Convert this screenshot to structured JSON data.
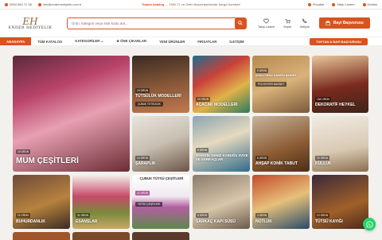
{
  "topbar": {
    "phone": "0554 560 72 38",
    "email": "info@enderhediyelik.com.tr",
    "promo_highlight": "Toptan katalog →",
    "promo_text": "1500 TL ve Üzeri Alışverişlerinizde Kargo Ücretsiz!",
    "links": [
      "Firsatlar",
      "Takip Listem",
      "Destek"
    ]
  },
  "header": {
    "logo_mono": "EH",
    "logo_name": "ENDER HEDIYELIK",
    "search_placeholder": "Ürün, kategori veya stok kodu ara...",
    "icons": [
      "Takip Listem",
      "Sepet",
      "İletişim"
    ],
    "cta": "Bayi Başvurusu"
  },
  "nav": {
    "items": [
      "ANASAYFA",
      "TÜM KATALOG",
      "KATEGORİLER ⌄",
      "★ ÖNE ÇIKANLAR",
      "YENİ ÜRÜNLER",
      "FIRSATLAR",
      "İLETİŞİM"
    ],
    "cta": "TOPTAN & BAYİ BAŞVURUSU"
  },
  "tiles": [
    {
      "id": "mum",
      "badge": "16 ÜRÜN",
      "title": "MUM ÇEŞİTLERİ"
    },
    {
      "id": "tut",
      "badge": "24 ÜRÜN",
      "title": "TÜTSÜLÜK MODELLERİ",
      "btn": "ÇUBUK TÜTSÜLÜK"
    },
    {
      "id": "aca",
      "badge": "20 ÜRÜN",
      "title": "AÇACAK MODELLERİ"
    },
    {
      "id": "ayn",
      "badge": "9 ÜRÜN",
      "title": "AYNALI DENİZ KABUĞU MAGNET",
      "btn": "POLYESTER MAGNET"
    },
    {
      "id": "dek",
      "badge": "154 ÜRÜN",
      "title": "DEKORATİF HEYKEL"
    },
    {
      "id": "sar",
      "badge": "14 ÜRÜN",
      "title": "ŞARAPLIK"
    },
    {
      "id": "sat",
      "badge": "8 ÜRÜN",
      "title": "ATANTİK DENİZ KABUĞU AVİZE VE SARKAÇLAR"
    },
    {
      "id": "ahs",
      "badge": "8 ÜRÜN",
      "title": "AHŞAP KONİK TABUT"
    },
    {
      "id": "kul",
      "badge": "20 ÜRÜN",
      "title": "KÜLLÜK"
    },
    {
      "id": "buh",
      "badge": "11 ÜRÜN",
      "title": "BUHURDANLIK"
    },
    {
      "id": "esa",
      "badge": "31 ÜRÜN",
      "title": "ESANSLAR"
    },
    {
      "id": "cub",
      "badge": "42 ÜRÜN",
      "title": "ÇUBUK TÜTSÜ ÇEŞİTLERİ",
      "btn": "TÜTSÜ ÇEŞİTLERİ"
    },
    {
      "id": "sap",
      "badge": "5 ÜRÜN",
      "title": "SARKAÇ KAPI SÜSÜ"
    },
    {
      "id": "not",
      "badge": "4 ÜRÜN",
      "title": "NOTLUK"
    },
    {
      "id": "tka",
      "badge": "12 ÜRÜN",
      "title": "TÜTSÜ KAYIĞI"
    }
  ],
  "colors": {
    "accent": "#d9531e",
    "whatsapp": "#25d366"
  }
}
